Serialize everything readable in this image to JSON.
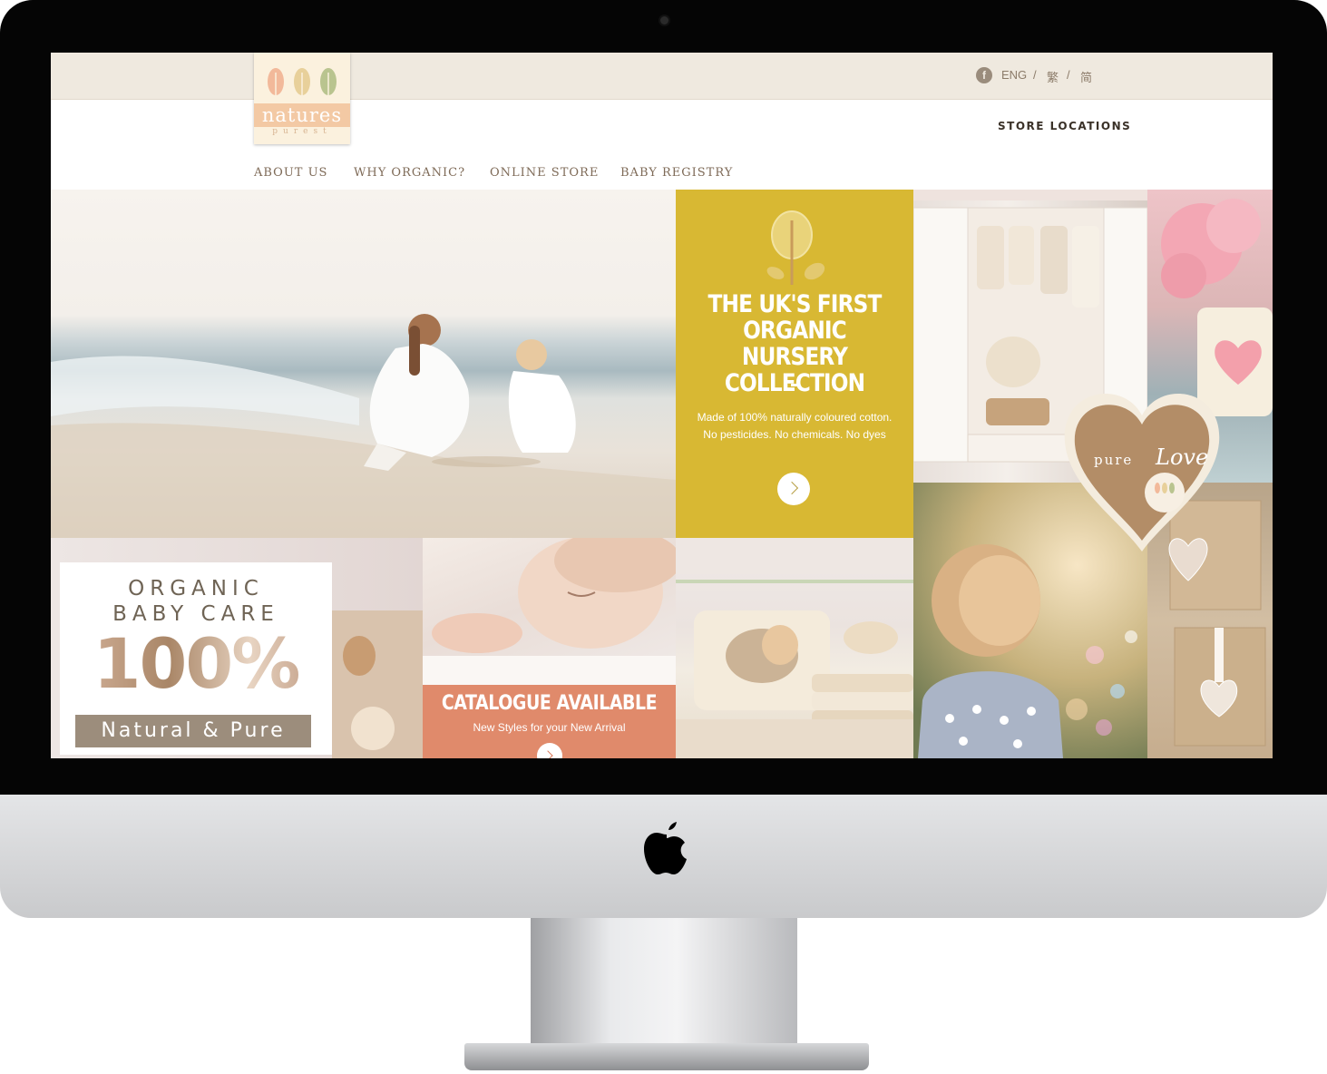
{
  "brand": {
    "logo_word": "natures",
    "logo_sub": "purest"
  },
  "topbar": {
    "social_icon": "facebook-icon",
    "languages": [
      "ENG",
      "/",
      "繁",
      "/",
      "简"
    ],
    "store_locations": "STORE LOCATIONS"
  },
  "nav": {
    "items": [
      "ABOUT US",
      "WHY ORGANIC?",
      "ONLINE STORE",
      "BABY REGISTRY"
    ]
  },
  "promo_yellow": {
    "title_lines": [
      "THE UK'S FIRST",
      "ORGANIC NURSERY",
      "COLLECTION"
    ],
    "desc_lines": [
      "Made of 100% naturally coloured cotton.",
      "No pesticides. No chemicals. No dyes"
    ]
  },
  "organic_card": {
    "line1": "ORGANIC",
    "line2": "BABY CARE",
    "big": "100%",
    "bar": "Natural & Pure"
  },
  "catalogue": {
    "title": "CATALOGUE AVAILABLE",
    "subtitle": "New Styles for your New Arrival"
  },
  "heart_tag": {
    "pure": "pure",
    "love": "Love"
  },
  "colors": {
    "topbar": "#efe9df",
    "nav_text": "#7e6a57",
    "yellow_tile": "#d8b833",
    "catalogue_tile": "#e08a6b",
    "organic_bar": "#9c8d7c"
  }
}
